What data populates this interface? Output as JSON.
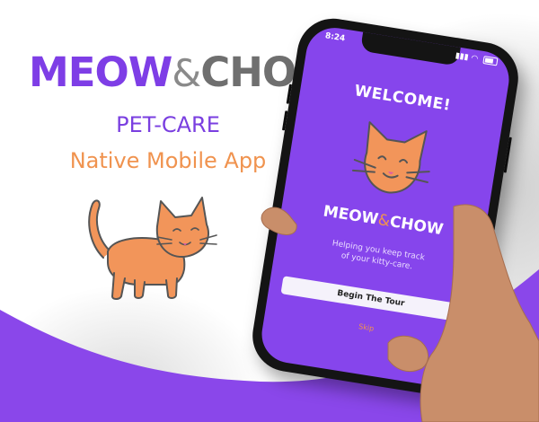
{
  "brand": {
    "logo_word1": "MEOW",
    "logo_amp": "&",
    "logo_word2": "CHOW",
    "subtitle": "PET-CARE",
    "tagline": "Native Mobile App"
  },
  "colors": {
    "purple": "#8645ec",
    "orange": "#f0934f",
    "gray": "#6f6f6f"
  },
  "phone": {
    "status_time": "8:24",
    "welcome": "WELCOME!",
    "logo_word1": "MEOW",
    "logo_amp": "&",
    "logo_word2": "CHOW",
    "helper_line1": "Helping you keep track",
    "helper_line2": "of your kitty-care.",
    "begin_button": "Begin The Tour",
    "skip_link": "Skip"
  },
  "icons": [
    "cat-illustration-icon",
    "cat-face-icon",
    "signal-icon",
    "wifi-icon",
    "battery-icon"
  ]
}
